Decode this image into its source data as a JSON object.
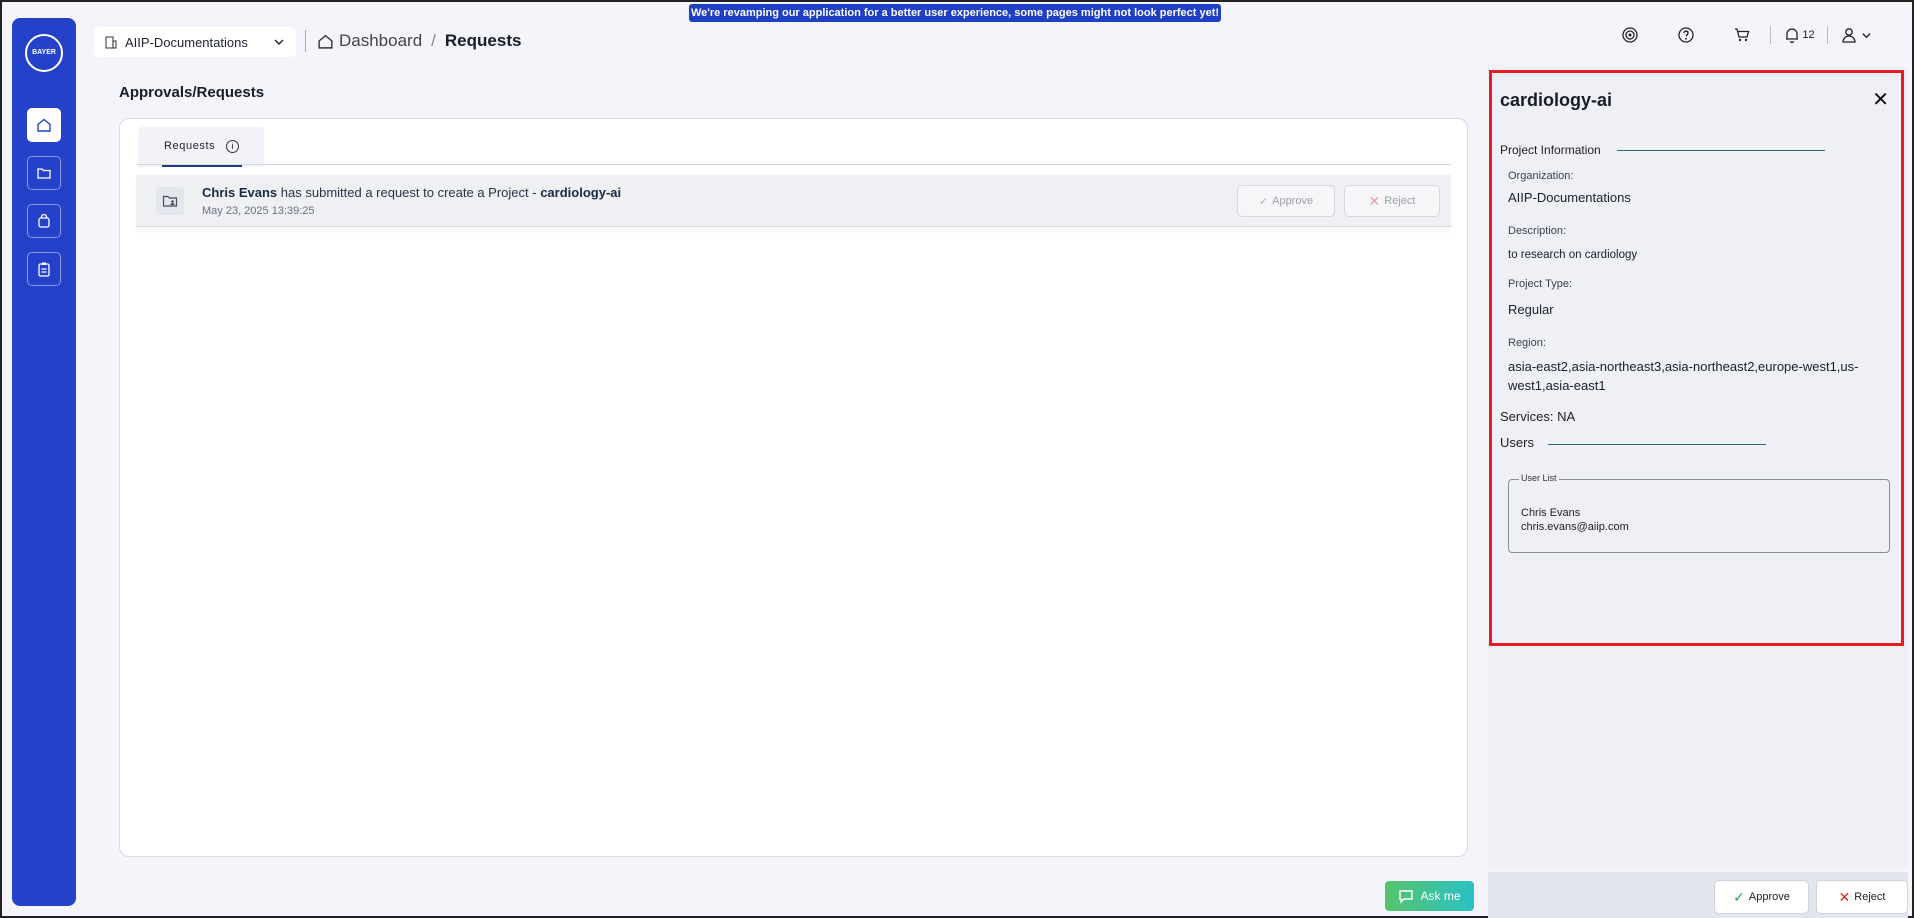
{
  "banner": "We're revamping our application for a better user experience, some pages might not look perfect yet!",
  "sidebar": {
    "logo_text": "BAYER",
    "items": [
      {
        "icon": "home-icon"
      },
      {
        "icon": "folder-icon"
      },
      {
        "icon": "bag-icon"
      },
      {
        "icon": "clipboard-icon"
      }
    ]
  },
  "header": {
    "org": "AIIP-Documentations",
    "breadcrumb": {
      "home": "Dashboard",
      "sep": "/",
      "current": "Requests"
    },
    "notifications_count": "12"
  },
  "main": {
    "title": "Approvals/Requests",
    "tab_label": "Requests",
    "request": {
      "user": "Chris Evans",
      "text": "has submitted a request to create a Project - ",
      "project": "cardiology-ai",
      "timestamp": "May 23, 2025 13:39:25",
      "approve_label": "Approve",
      "reject_label": "Reject"
    }
  },
  "panel": {
    "title": "cardiology-ai",
    "section_project": "Project Information",
    "organization_label": "Organization:",
    "organization": "AIIP-Documentations",
    "description_label": "Description:",
    "description": "to research on cardiology",
    "type_label": "Project Type:",
    "type": "Regular",
    "region_label": "Region:",
    "region_line1": "asia-east2,asia-northeast3,asia-northeast2,europe-west1,us-",
    "region_line2": "west1,asia-east1",
    "services": "Services: NA",
    "section_users": "Users",
    "user_list_label": "User List",
    "user_name": "Chris Evans",
    "user_email": "chris.evans@aiip.com"
  },
  "footer": {
    "approve_label": "Approve",
    "reject_label": "Reject",
    "ask_label": "Ask me"
  },
  "colors": {
    "accent": "#2442c9",
    "highlight": "#e51c23",
    "reject": "#e02020",
    "approve": "#2e9a4a"
  }
}
